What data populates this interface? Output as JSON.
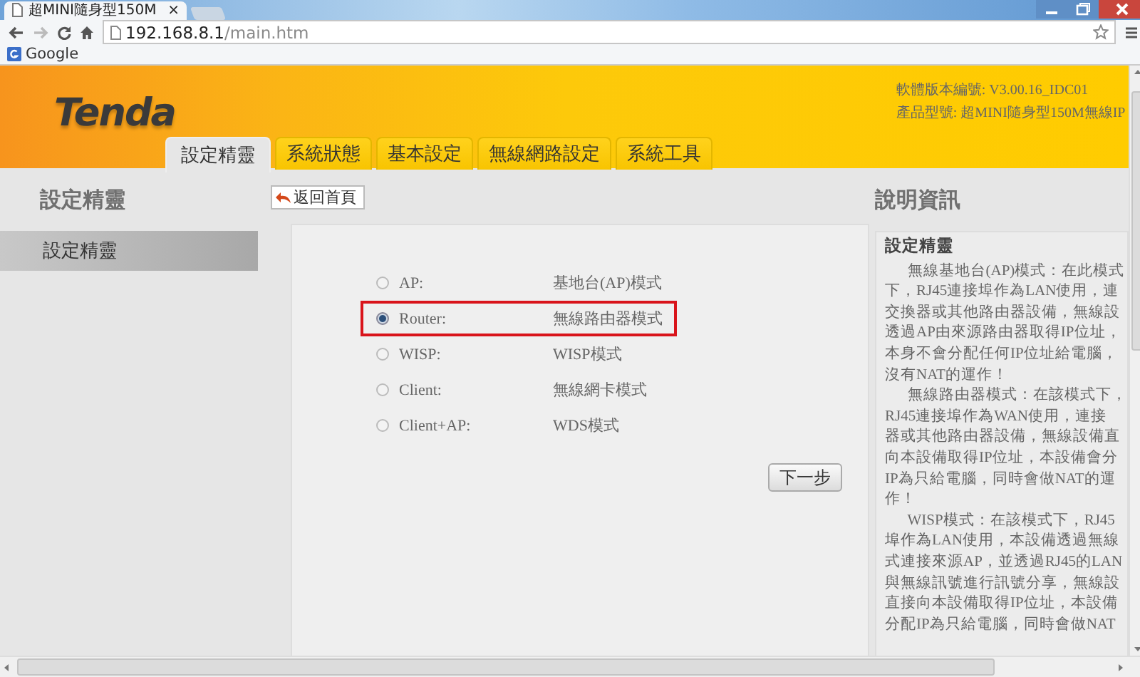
{
  "browser": {
    "tab_title": "超MINI隨身型150M",
    "tab_close": "×",
    "url_host": "192.168.8.1",
    "url_path": "/main.htm",
    "bookmarks": [
      "Google"
    ]
  },
  "header": {
    "logo": "Tenda",
    "firmware": "軟體版本編號: V3.00.16_IDC01",
    "model": "產品型號: 超MINI隨身型150M無線IP",
    "tabs": [
      {
        "label": "設定精靈",
        "selected": true
      },
      {
        "label": "系統狀態",
        "selected": false
      },
      {
        "label": "基本設定",
        "selected": false
      },
      {
        "label": "無線網路設定",
        "selected": false
      },
      {
        "label": "系統工具",
        "selected": false
      }
    ]
  },
  "sidebar": {
    "title": "設定精靈",
    "items": [
      {
        "label": "設定精靈",
        "selected": true
      }
    ]
  },
  "main": {
    "back_button": "返回首頁",
    "modes": [
      {
        "label": "AP:",
        "description": "基地台(AP)模式",
        "selected": false
      },
      {
        "label": "Router:",
        "description": "無線路由器模式",
        "selected": true
      },
      {
        "label": "WISP:",
        "description": "WISP模式",
        "selected": false
      },
      {
        "label": "Client:",
        "description": "無線網卡模式",
        "selected": false
      },
      {
        "label": "Client+AP:",
        "description": "WDS模式",
        "selected": false
      }
    ],
    "next_button": "下一步"
  },
  "help": {
    "title": "說明資訊",
    "heading": "設定精靈",
    "paragraphs": [
      {
        "lines": [
          "無線基地台(AP)模式：在此模式",
          "下，RJ45連接埠作為LAN使用，連",
          "交換器或其他路由器設備，無線設",
          "透過AP由來源路由器取得IP位址，",
          "本身不會分配任何IP位址給電腦，",
          "沒有NAT的運作！"
        ]
      },
      {
        "lines": [
          "無線路由器模式：在該模式下，",
          "RJ45連接埠作為WAN使用，連接",
          "器或其他路由器設備，無線設備直",
          "向本設備取得IP位址，本設備會分",
          "IP為只給電腦，同時會做NAT的運",
          "作！"
        ]
      },
      {
        "lines": [
          "WISP模式：在該模式下，RJ45",
          "埠作為LAN使用，本設備透過無線",
          "式連接來源AP，並透過RJ45的LAN",
          "與無線訊號進行訊號分享，無線設",
          "直接向本設備取得IP位址，本設備",
          "分配IP為只給電腦，同時會做NAT"
        ]
      }
    ]
  }
}
